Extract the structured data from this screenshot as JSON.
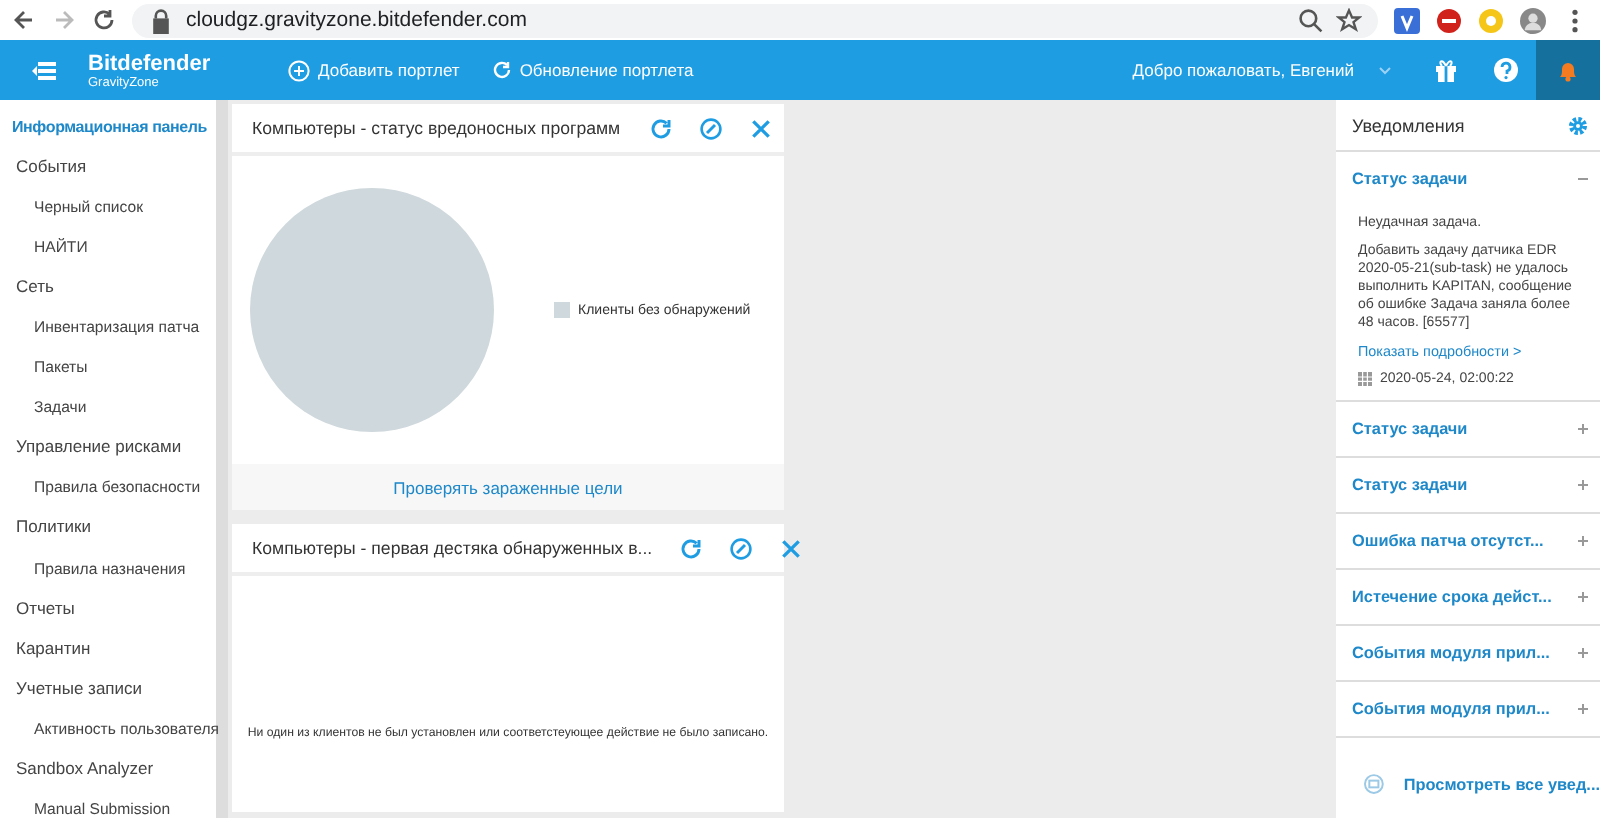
{
  "browser": {
    "url": "cloudgz.gravityzone.bitdefender.com"
  },
  "header": {
    "brand": "Bitdefender",
    "product": "GravityZone",
    "actions": [
      "Добавить портлет",
      "Обновление портлета"
    ],
    "welcome": "Добро пожаловать, Евгений"
  },
  "sidebar": {
    "items": [
      {
        "label": "Информационная панель",
        "selected": true
      },
      {
        "label": "События",
        "selected": false,
        "children": [
          {
            "label": "Черный список",
            "selected": false
          },
          {
            "label": "НАЙТИ",
            "selected": false
          }
        ]
      },
      {
        "label": "Сеть",
        "selected": false,
        "children": [
          {
            "label": "Инвентаризация патча",
            "selected": false
          },
          {
            "label": "Пакеты",
            "selected": false
          },
          {
            "label": "Задачи",
            "selected": false
          }
        ]
      },
      {
        "label": "Управление рисками",
        "selected": false,
        "children": [
          {
            "label": "Правила безопасности",
            "selected": false
          }
        ]
      },
      {
        "label": "Политики",
        "selected": false,
        "children": [
          {
            "label": "Правила назначения",
            "selected": false
          }
        ]
      },
      {
        "label": "Отчеты",
        "selected": false
      },
      {
        "label": "Карантин",
        "selected": false
      },
      {
        "label": "Учетные записи",
        "selected": false,
        "children": [
          {
            "label": "Активность пользователя",
            "selected": false
          }
        ]
      },
      {
        "label": "Sandbox Analyzer",
        "selected": false,
        "children": [
          {
            "label": "Manual Submission",
            "selected": false
          }
        ]
      }
    ]
  },
  "portlets": [
    {
      "kind": "pie",
      "title": "Компьютеры - статус вредоносных программ",
      "legend": [
        {
          "label": "Клиенты без обнаружений",
          "color": "#cfd8dc"
        }
      ],
      "footer_link": "Проверять зараженные цели"
    },
    {
      "kind": "message",
      "title": "Компьютеры - первая дестяка обнаруженных в...",
      "message": "Ни один из клиентов не был установлен или соответстеующее действие не было записано."
    }
  ],
  "notifications": {
    "title": "Уведомления",
    "items": [
      {
        "title": "Статус задачи",
        "expanded": true,
        "status": "Неудачная задача.",
        "text": "Добавить задачу датчика EDR 2020-05-21(sub-task) не удалось выполнить KAPITAN, сообщение об ошибке Задача заняла более 48 часов. [65577]",
        "details_link": "Показать подробности >",
        "date": "2020-05-24, 02:00:22"
      },
      {
        "title": "Статус задачи",
        "expanded": false
      },
      {
        "title": "Статус задачи",
        "expanded": false
      },
      {
        "title": "Ошибка патча отсутст...",
        "expanded": false
      },
      {
        "title": "Истечение срока дейст...",
        "expanded": false
      },
      {
        "title": "События модуля прил...",
        "expanded": false
      },
      {
        "title": "События модуля прил...",
        "expanded": false
      }
    ],
    "view_all": "Просмотреть все увед..."
  }
}
